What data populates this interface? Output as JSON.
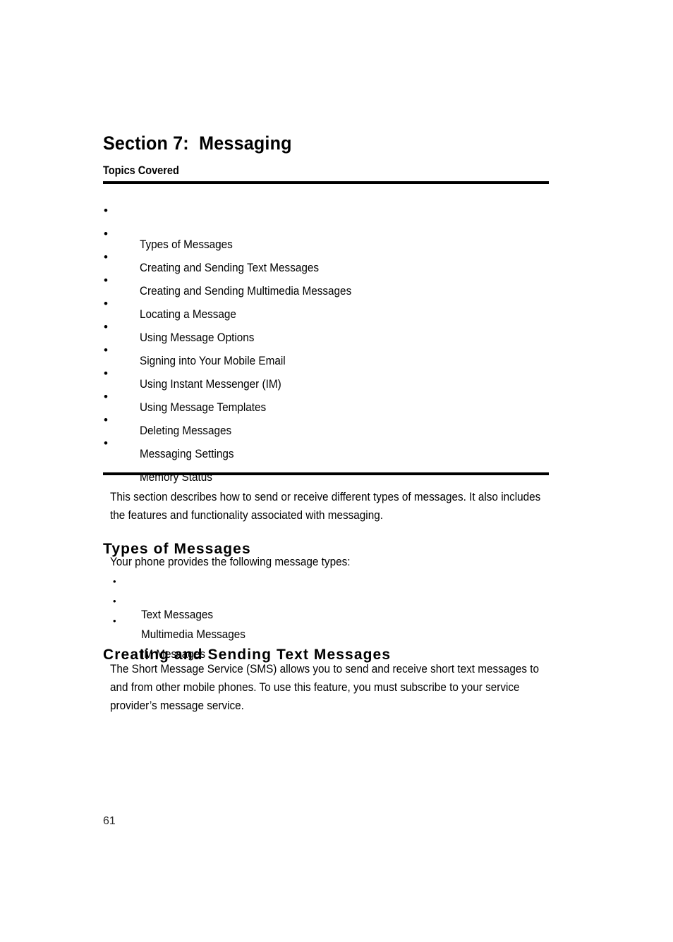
{
  "page": {
    "section_title": "Section 7:  Messaging",
    "topics_label": "Topics Covered",
    "page_number": "61"
  },
  "topics": [
    {
      "label": "Types of Messages"
    },
    {
      "label": "Creating and Sending Text Messages"
    },
    {
      "label": "Creating and Sending Multimedia Messages"
    },
    {
      "label": "Locating a Message"
    },
    {
      "label": "Using Message Options"
    },
    {
      "label": "Signing into Your Mobile Email"
    },
    {
      "label": "Using Instant Messenger (IM)"
    },
    {
      "label": "Using Message Templates"
    },
    {
      "label": "Deleting Messages"
    },
    {
      "label": "Messaging Settings"
    },
    {
      "label": "Memory Status"
    }
  ],
  "intro": {
    "paragraph": "This section describes how to send or receive different types of messages. It also includes the features and functionality associated with messaging."
  },
  "types_of_messages": {
    "heading": "Types of Messages",
    "intro": "Your phone provides the following message types:",
    "items": [
      {
        "label": "Text Messages"
      },
      {
        "label": "Multimedia Messages"
      },
      {
        "label": "IM Messages"
      }
    ]
  },
  "creating_text_messages": {
    "heading": "Creating and Sending Text Messages",
    "paragraph": "The Short Message Service (SMS) allows you to send and receive short text messages to and from other mobile phones. To use this feature, you must subscribe to your service provider’s message service."
  },
  "glyphs": {
    "bullet": "•"
  }
}
